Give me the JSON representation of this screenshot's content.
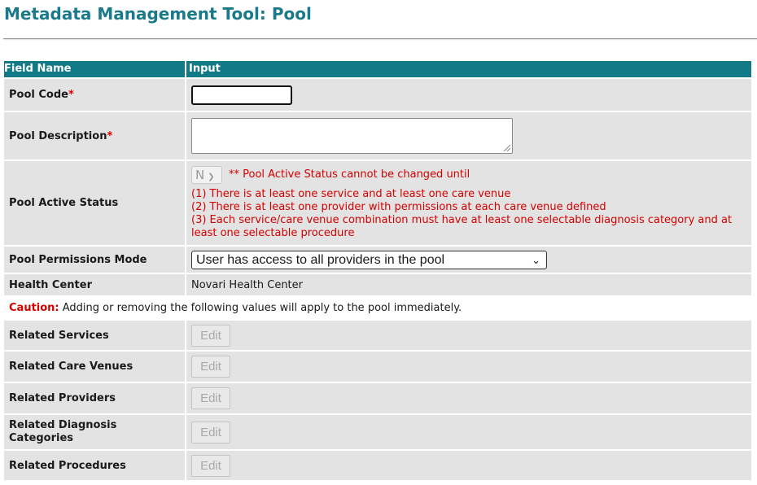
{
  "page": {
    "title": "Metadata Management Tool: Pool"
  },
  "table": {
    "col_field": "Field Name",
    "col_input": "Input"
  },
  "required_mark": "*",
  "pool_code": {
    "label": "Pool Code",
    "value": ""
  },
  "pool_description": {
    "label": "Pool Description",
    "value": ""
  },
  "pool_active_status": {
    "label": "Pool Active Status",
    "selected": "N",
    "notice_title": "** Pool Active Status cannot be changed until",
    "conditions": [
      "(1) There is at least one service and at least one care venue",
      "(2) There is at least one provider with permissions at each care venue defined",
      "(3) Each service/care venue combination must have at least one selectable diagnosis category and at least one selectable procedure"
    ]
  },
  "pool_permissions_mode": {
    "label": "Pool Permissions Mode",
    "selected": "User has access to all providers in the pool"
  },
  "health_center": {
    "label": "Health Center",
    "value": "Novari Health Center"
  },
  "caution": {
    "label": "Caution:",
    "text": "Adding or removing the following values will apply to the pool immediately."
  },
  "related": [
    {
      "label": "Related Services",
      "button": "Edit"
    },
    {
      "label": "Related Care Venues",
      "button": "Edit"
    },
    {
      "label": "Related Providers",
      "button": "Edit"
    },
    {
      "label": "Related Diagnosis Categories",
      "button": "Edit"
    },
    {
      "label": "Related Procedures",
      "button": "Edit"
    }
  ],
  "colors": {
    "title": "#1a7a8a",
    "header_bg": "#127a86",
    "row_bg": "#e3e3e3",
    "warning": "#d40000"
  }
}
